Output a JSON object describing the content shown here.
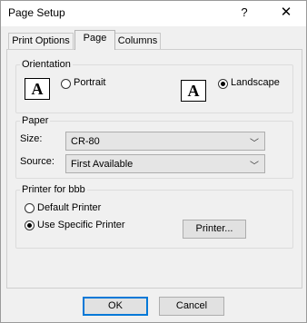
{
  "window": {
    "title": "Page Setup",
    "help_glyph": "?",
    "close_glyph": "✕"
  },
  "tabs": [
    {
      "label": "Print Options",
      "active": false
    },
    {
      "label": "Page",
      "active": true
    },
    {
      "label": "Columns",
      "active": false
    }
  ],
  "orientation": {
    "group_label": "Orientation",
    "icon_letter": "A",
    "portrait_label": "Portrait",
    "landscape_label": "Landscape",
    "selected": "landscape"
  },
  "paper": {
    "group_label": "Paper",
    "size_label": "Size:",
    "size_value": "CR-80",
    "source_label": "Source:",
    "source_value": "First Available",
    "chevron": "﹀"
  },
  "printer": {
    "group_label": "Printer for bbb",
    "default_label": "Default Printer",
    "specific_label": "Use Specific Printer",
    "selected": "specific",
    "printer_button": "Printer..."
  },
  "buttons": {
    "ok": "OK",
    "cancel": "Cancel"
  }
}
